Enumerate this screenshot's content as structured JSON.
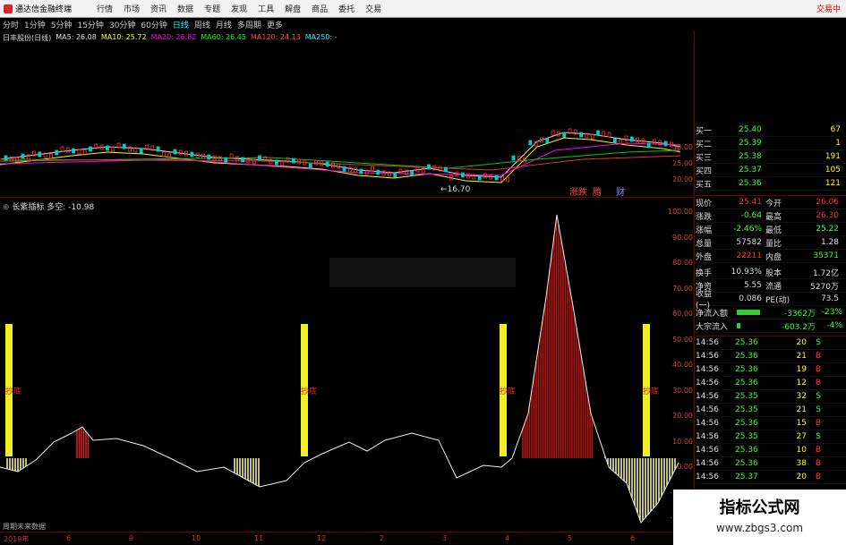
{
  "menubar": {
    "app_title": "通达信金融终端",
    "items": [
      "行情",
      "市场",
      "资讯",
      "数据",
      "专题",
      "发现",
      "工具",
      "解盘",
      "商品",
      "委托",
      "交易"
    ],
    "trade_label": "交易中"
  },
  "periods": [
    "分时",
    "1分钟",
    "5分钟",
    "15分钟",
    "30分钟",
    "60分钟",
    "日线",
    "周线",
    "月线",
    "多周期",
    "更多"
  ],
  "selected_period": "日线",
  "ma_legend": {
    "title": "日丰股份(日线)",
    "items": [
      {
        "label": "MA5: 26.08",
        "color": "#ddd"
      },
      {
        "label": "MA10: 25.72",
        "color": "#ff0"
      },
      {
        "label": "MA20: 26.82",
        "color": "#f0f"
      },
      {
        "label": "MA60: 26.45",
        "color": "#0f0"
      },
      {
        "label": "MA120: 24.13",
        "color": "#f44"
      },
      {
        "label": "MA250: -",
        "color": "#0ff"
      }
    ]
  },
  "kchart": {
    "low_marker": "←16.70",
    "tags": [
      {
        "text": "涨跌",
        "color": "#f44"
      },
      {
        "text": "腾",
        "color": "#f44"
      },
      {
        "text": "财",
        "color": "#88f"
      }
    ],
    "y_ticks": [
      "30.00",
      "25.00",
      "20.00"
    ]
  },
  "indicator": {
    "title": "长紫插标 多空: -10.98",
    "bar_label": "抄底",
    "y_ticks": [
      "100.00",
      "90.00",
      "80.00",
      "70.00",
      "60.00",
      "50.00",
      "40.00",
      "30.00",
      "20.00",
      "10.00",
      "0.00",
      "-10.00",
      "-20.00"
    ]
  },
  "xaxis": {
    "left_text": "周期未来数据",
    "ticks": [
      "2019年",
      "6",
      "9",
      "10",
      "11",
      "12",
      "2",
      "3",
      "4",
      "5",
      "6"
    ]
  },
  "quote": {
    "buys": [
      {
        "label": "买一",
        "price": "25.40",
        "vol": "67"
      },
      {
        "label": "买二",
        "price": "25.39",
        "vol": "1"
      },
      {
        "label": "买三",
        "price": "25.38",
        "vol": "191"
      },
      {
        "label": "买四",
        "price": "25.37",
        "vol": "105"
      },
      {
        "label": "买五",
        "price": "25.36",
        "vol": "121"
      }
    ],
    "stats": [
      {
        "l1": "现价",
        "v1": "25.41",
        "c1": "red",
        "l2": "今开",
        "v2": "26.06",
        "c2": "red"
      },
      {
        "l1": "涨跌",
        "v1": "-0.64",
        "c1": "grn",
        "l2": "最高",
        "v2": "26.30",
        "c2": "red"
      },
      {
        "l1": "涨幅",
        "v1": "-2.46%",
        "c1": "grn",
        "l2": "最低",
        "v2": "25.22",
        "c2": "grn"
      },
      {
        "l1": "总量",
        "v1": "57582",
        "c1": "wht",
        "l2": "量比",
        "v2": "1.28",
        "c2": "wht"
      },
      {
        "l1": "外盘",
        "v1": "22211",
        "c1": "red",
        "l2": "内盘",
        "v2": "35371",
        "c2": "grn"
      },
      {
        "l1": "换手",
        "v1": "10.93%",
        "c1": "wht",
        "l2": "股本",
        "v2": "1.72亿",
        "c2": "wht"
      },
      {
        "l1": "净资",
        "v1": "5.55",
        "c1": "wht",
        "l2": "流通",
        "v2": "5270万",
        "c2": "wht"
      },
      {
        "l1": "收益(一)",
        "v1": "0.086",
        "c1": "wht",
        "l2": "PE(动)",
        "v2": "73.5",
        "c2": "wht"
      }
    ],
    "flows": [
      {
        "label": "净流入额",
        "value": "-3362万",
        "pct": "-23%"
      },
      {
        "label": "大宗流入",
        "value": "-603.2万",
        "pct": "-4%"
      }
    ],
    "ticks": [
      {
        "t": "14:56",
        "p": "25.36",
        "v": "20",
        "d": "S"
      },
      {
        "t": "14:56",
        "p": "25.36",
        "v": "21",
        "d": "B"
      },
      {
        "t": "14:56",
        "p": "25.36",
        "v": "19",
        "d": "B"
      },
      {
        "t": "14:56",
        "p": "25.36",
        "v": "12",
        "d": "B"
      },
      {
        "t": "14:56",
        "p": "25.35",
        "v": "32",
        "d": "S"
      },
      {
        "t": "14:56",
        "p": "25.35",
        "v": "21",
        "d": "S"
      },
      {
        "t": "14:56",
        "p": "25.36",
        "v": "15",
        "d": "B"
      },
      {
        "t": "14:56",
        "p": "25.35",
        "v": "27",
        "d": "S"
      },
      {
        "t": "14:56",
        "p": "25.36",
        "v": "10",
        "d": "B"
      },
      {
        "t": "14:56",
        "p": "25.36",
        "v": "38",
        "d": "B"
      },
      {
        "t": "14:56",
        "p": "25.37",
        "v": "20",
        "d": "B"
      }
    ]
  },
  "watermark": {
    "line1": "指标公式网",
    "line2": "www.zbgs3.com"
  }
}
